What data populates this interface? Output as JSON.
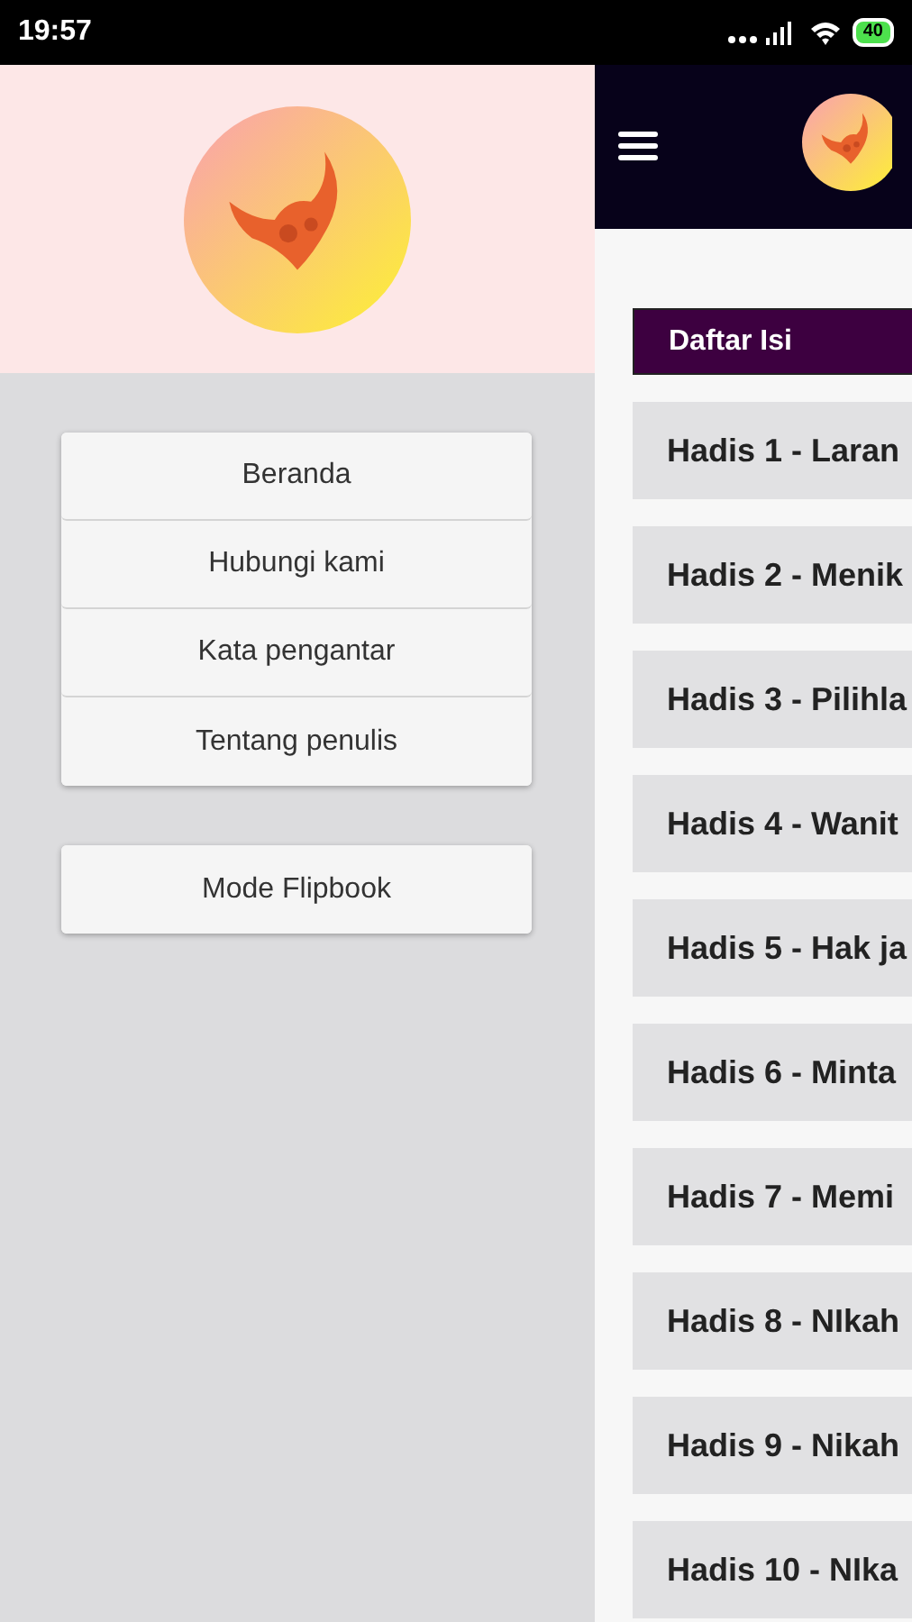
{
  "status_bar": {
    "time": "19:57",
    "battery": "40"
  },
  "drawer": {
    "menu": [
      {
        "label": "Beranda"
      },
      {
        "label": "Hubungi kami"
      },
      {
        "label": "Kata pengantar"
      },
      {
        "label": "Tentang penulis"
      }
    ],
    "extra": [
      {
        "label": "Mode Flipbook"
      }
    ]
  },
  "content": {
    "section_title": "Daftar Isi",
    "items": [
      {
        "label": "Hadis 1 - Laran"
      },
      {
        "label": "Hadis 2 - Menik"
      },
      {
        "label": "Hadis 3 - Pilihla"
      },
      {
        "label": "Hadis 4 - Wanit"
      },
      {
        "label": "Hadis 5 - Hak ja"
      },
      {
        "label": "Hadis 6 - Minta"
      },
      {
        "label": "Hadis 7 - Memi"
      },
      {
        "label": "Hadis 8 - NIkah"
      },
      {
        "label": "Hadis 9 - Nikah"
      },
      {
        "label": "Hadis 10 - NIka"
      }
    ]
  }
}
